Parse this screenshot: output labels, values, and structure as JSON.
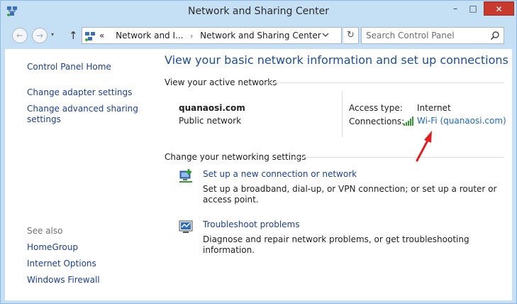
{
  "window": {
    "title": "Network and Sharing Center",
    "minimize_glyph": "–",
    "maximize_glyph": "□",
    "close_glyph": "✕"
  },
  "nav": {
    "back_glyph": "←",
    "forward_glyph": "→",
    "dropdown_glyph": "▾",
    "up_glyph": "↑",
    "address_prefix": "«",
    "breadcrumb": [
      "Network and I...",
      "Network and Sharing Center"
    ],
    "breadcrumb_sep": "›",
    "address_chevron": "⌵",
    "refresh_glyph": "↻",
    "search_placeholder": "Search Control Panel"
  },
  "sidebar": {
    "items": [
      {
        "label": "Control Panel Home"
      },
      {
        "label": "Change adapter settings"
      },
      {
        "label": "Change advanced sharing settings"
      }
    ],
    "see_also_label": "See also",
    "see_also": [
      {
        "label": "HomeGroup"
      },
      {
        "label": "Internet Options"
      },
      {
        "label": "Windows Firewall"
      }
    ]
  },
  "main": {
    "heading": "View your basic network information and set up connections",
    "active_networks_label": "View your active networks",
    "network": {
      "name": "quanaosi.com",
      "category": "Public network",
      "access_type_label": "Access type:",
      "access_type_value": "Internet",
      "connections_label": "Connections:",
      "connection_link": "Wi-Fi (quanaosi.com)"
    },
    "change_settings_label": "Change your networking settings",
    "tasks": [
      {
        "icon": "new-connection-icon",
        "title": "Set up a new connection or network",
        "description": "Set up a broadband, dial-up, or VPN connection; or set up a router or access point."
      },
      {
        "icon": "troubleshoot-icon",
        "title": "Troubleshoot problems",
        "description": "Diagnose and repair network problems, or get troubleshooting information."
      }
    ]
  },
  "colors": {
    "link": "#1c3f94",
    "heading": "#1e4e94",
    "frame": "#c5dff5",
    "close_button": "#c73a2d",
    "annotation_arrow": "#e02020"
  }
}
